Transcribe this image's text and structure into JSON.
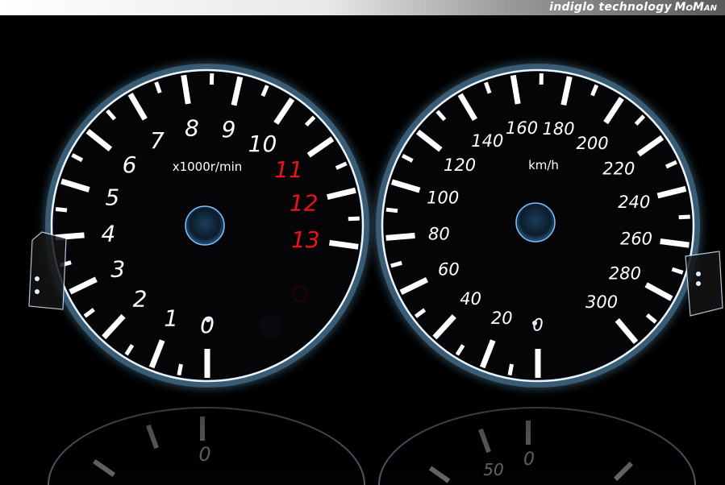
{
  "banner": {
    "text": "indiglo technology",
    "brand": "MoMan"
  },
  "tachometer": {
    "unit": "x1000r/min",
    "numerals": [
      "0",
      "1",
      "2",
      "3",
      "4",
      "5",
      "6",
      "7",
      "8",
      "9",
      "10",
      "11",
      "12",
      "13"
    ],
    "redline_numerals": [
      "11",
      "12",
      "13"
    ]
  },
  "speedometer": {
    "unit": "km/h",
    "numerals": [
      "0",
      "20",
      "40",
      "60",
      "80",
      "100",
      "120",
      "140",
      "160",
      "180",
      "200",
      "220",
      "240",
      "260",
      "280",
      "300"
    ]
  },
  "reflection": {
    "numerals": [
      "0",
      "50",
      "0"
    ]
  },
  "colors": {
    "background": "#000000",
    "dial": "#050508",
    "glow": "#9fd8ff",
    "markings": "#ffffff",
    "redline": "#e8141c"
  }
}
